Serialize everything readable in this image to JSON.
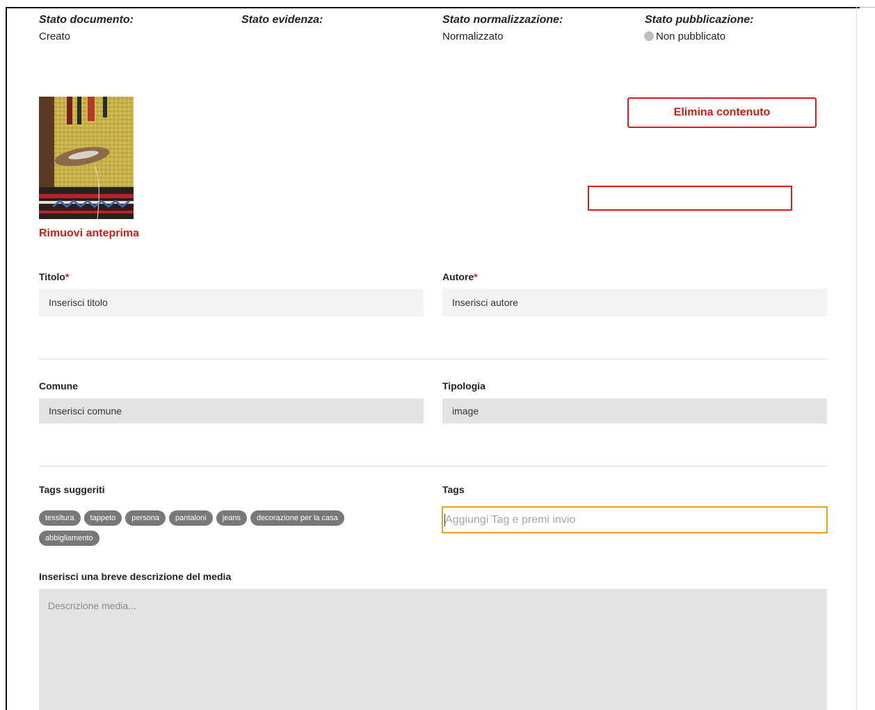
{
  "status": {
    "documento": {
      "label": "Stato documento:",
      "value": "Creato"
    },
    "evidenza": {
      "label": "Stato evidenza:",
      "value": ""
    },
    "normalizzazione": {
      "label": "Stato normalizzazione:",
      "value": "Normalizzato"
    },
    "pubblicazione": {
      "label": "Stato pubblicazione:",
      "value": "Non pubblicato"
    }
  },
  "preview": {
    "remove_label": "Rimuovi anteprima"
  },
  "actions": {
    "delete_label": "Elimina contenuto"
  },
  "form": {
    "titolo": {
      "label": "Titolo",
      "required": "*",
      "placeholder": "Inserisci titolo"
    },
    "autore": {
      "label": "Autore",
      "required": "*",
      "placeholder": "Inserisci autore"
    },
    "comune": {
      "label": "Comune",
      "placeholder": "Inserisci comune"
    },
    "tipologia": {
      "label": "Tipologia",
      "value": "image"
    },
    "tags_suggeriti": {
      "label": "Tags suggeriti",
      "items": [
        "tessitura",
        "tappeto",
        "persona",
        "pantaloni",
        "jeans",
        "decorazione per la casa",
        "abbigliamento"
      ]
    },
    "tags": {
      "label": "Tags",
      "placeholder": "Aggiungi Tag e premi invio"
    },
    "descrizione": {
      "label": "Inserisci una breve descrizione del media",
      "placeholder": "Descrizione media..."
    }
  },
  "colors": {
    "accent_red": "#d81e16",
    "focus_orange": "#f0a11c",
    "tag_bg": "#787878"
  }
}
